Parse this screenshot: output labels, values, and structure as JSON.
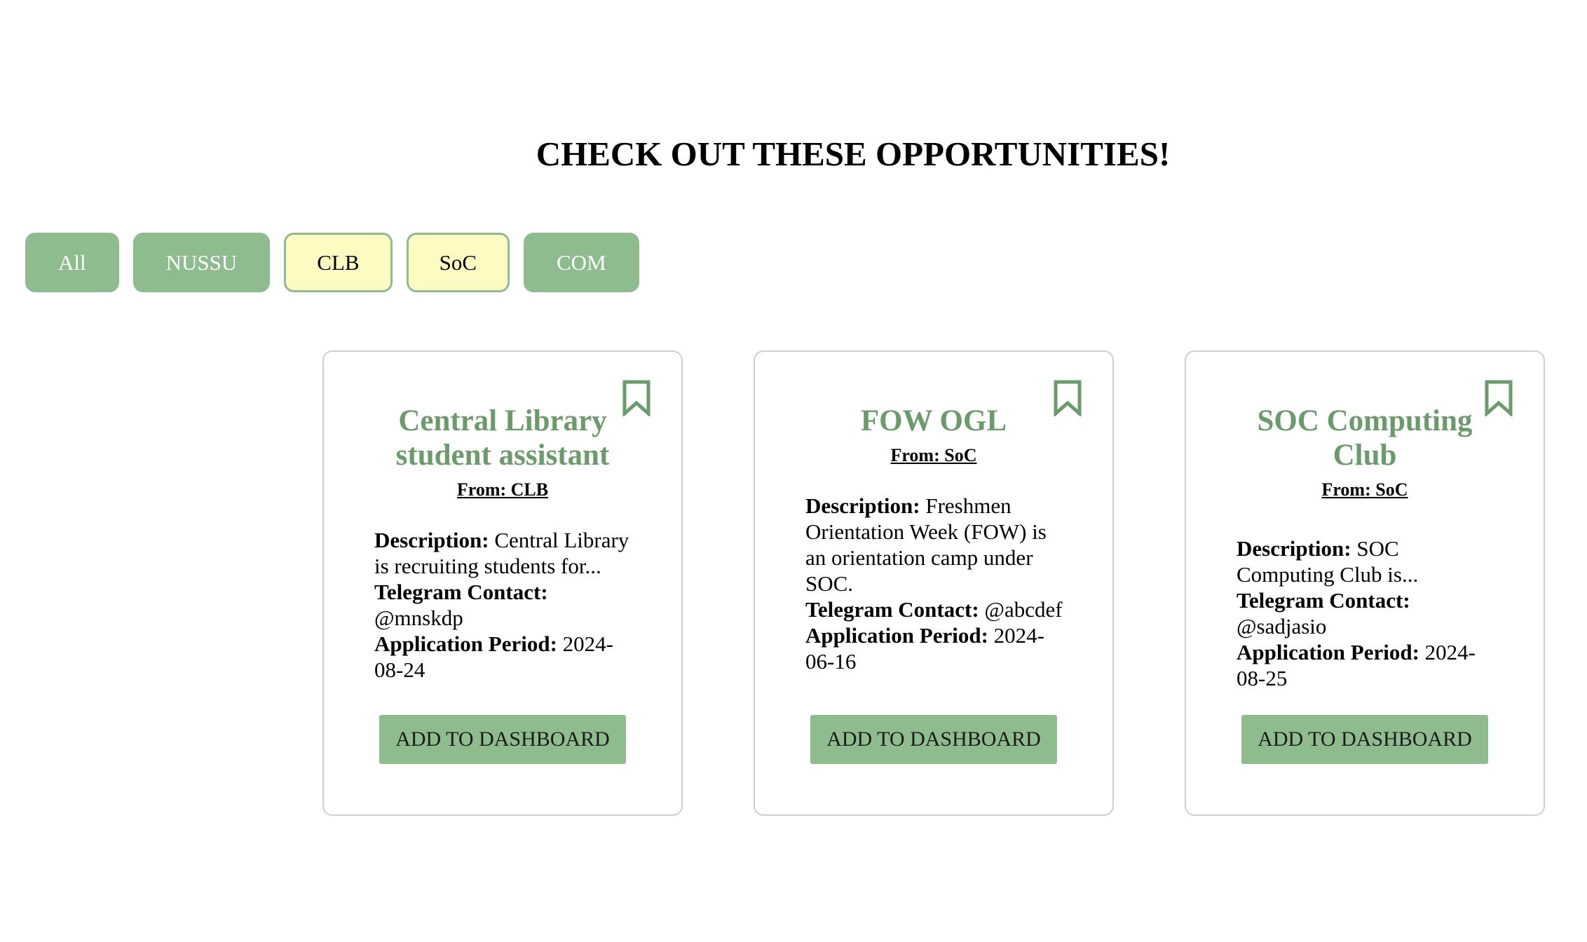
{
  "page": {
    "heading": "CHECK OUT THESE OPPORTUNITIES!"
  },
  "filters": [
    {
      "label": "All",
      "state": "inactive"
    },
    {
      "label": "NUSSU",
      "state": "inactive"
    },
    {
      "label": "CLB",
      "state": "active"
    },
    {
      "label": "SoC",
      "state": "active"
    },
    {
      "label": "COM",
      "state": "inactive"
    }
  ],
  "cards": [
    {
      "title": "Central Library student assistant",
      "from": "From: CLB",
      "description_label": "Description:",
      "description": " Central Library is recruiting students for...",
      "telegram_label": "Telegram Contact:",
      "telegram": " @mnskdp",
      "period_label": "Application Period:",
      "period": " 2024-08-24",
      "button_label": "ADD TO DASHBOARD",
      "bookmark_icon": "bookmark-icon"
    },
    {
      "title": "FOW OGL",
      "from": "From: SoC",
      "description_label": "Description:",
      "description": " Freshmen Orientation Week (FOW) is an orientation camp under SOC.",
      "telegram_label": "Telegram Contact:",
      "telegram": " @abcdef",
      "period_label": "Application Period:",
      "period": " 2024-06-16",
      "button_label": "ADD TO DASHBOARD",
      "bookmark_icon": "bookmark-icon"
    },
    {
      "title": "SOC Computing Club",
      "from": "From: SoC",
      "description_label": "Description:",
      "description": " SOC Computing Club is...",
      "telegram_label": "Telegram Contact:",
      "telegram": " @sadjasio",
      "period_label": "Application Period:",
      "period": " 2024-08-25",
      "button_label": "ADD TO DASHBOARD",
      "bookmark_icon": "bookmark-icon"
    }
  ],
  "colors": {
    "accent": "#8fbc8f",
    "title_green": "#6b9a6b",
    "active_filter_bg": "#fdfbc2"
  }
}
